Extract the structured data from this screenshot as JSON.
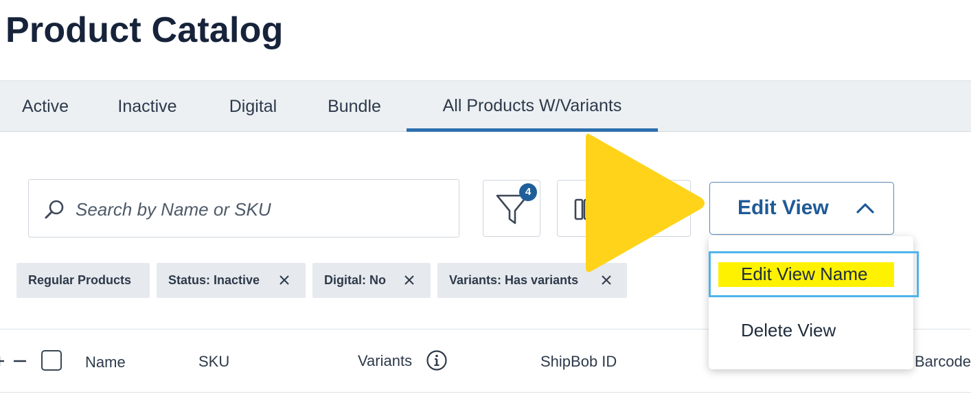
{
  "page": {
    "title": "Product Catalog"
  },
  "tabs": [
    {
      "label": "Active"
    },
    {
      "label": "Inactive"
    },
    {
      "label": "Digital"
    },
    {
      "label": "Bundle"
    },
    {
      "label": "All Products W/Variants",
      "active": true
    }
  ],
  "search": {
    "placeholder": "Search by Name or SKU",
    "value": ""
  },
  "toolbar": {
    "filter_count": "4",
    "edit_view_label": "Edit View"
  },
  "chips": [
    {
      "label": "Regular Products",
      "removable": false
    },
    {
      "label": "Status: Inactive",
      "removable": true
    },
    {
      "label": "Digital: No",
      "removable": true
    },
    {
      "label": "Variants: Has variants",
      "removable": true
    }
  ],
  "table": {
    "columns": [
      "Name",
      "SKU",
      "Variants",
      "ShipBob ID",
      "Barcode"
    ]
  },
  "edit_view_menu": {
    "items": [
      {
        "label": "Edit View Name",
        "highlighted": true
      },
      {
        "label": "Delete View"
      }
    ]
  },
  "colors": {
    "accent": "#2f6fae",
    "badge": "#1f5f99",
    "highlight": "#fff200",
    "focus_ring": "#4db3ea",
    "overlay": "#ffd31a"
  }
}
